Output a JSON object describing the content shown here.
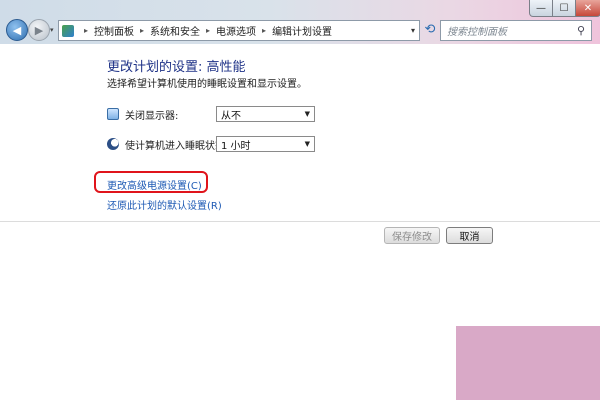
{
  "window": {
    "minimize_glyph": "—",
    "maximize_glyph": "☐",
    "close_glyph": "✕"
  },
  "nav": {
    "back_glyph": "◀",
    "forward_glyph": "▶",
    "history_glyph": "▾"
  },
  "address_bar": {
    "icon": "control-panel-icon",
    "breadcrumb": [
      "控制面板",
      "系统和安全",
      "电源选项",
      "编辑计划设置"
    ],
    "separator": "▸",
    "dropdown_glyph": "▾"
  },
  "refresh_glyph": "⟲",
  "search": {
    "placeholder": "搜索控制面板",
    "icon_glyph": "⚲"
  },
  "page": {
    "title": "更改计划的设置: 高性能",
    "subtitle": "选择希望计算机使用的睡眠设置和显示设置。",
    "settings": [
      {
        "icon": "monitor-icon",
        "label": "关闭显示器:",
        "value": "从不"
      },
      {
        "icon": "sleep-moon-icon",
        "label": "使计算机进入睡眠状态:",
        "value": "1 小时"
      }
    ],
    "advanced_link": "更改高级电源设置(C)",
    "restore_link": "还原此计划的默认设置(R)",
    "save_button": "保存修改",
    "cancel_button": "取消"
  },
  "colors": {
    "title": "#1e3287",
    "link": "#1e5ab4",
    "highlight": "#e0141b",
    "pink_background": "#d9a9c7"
  }
}
